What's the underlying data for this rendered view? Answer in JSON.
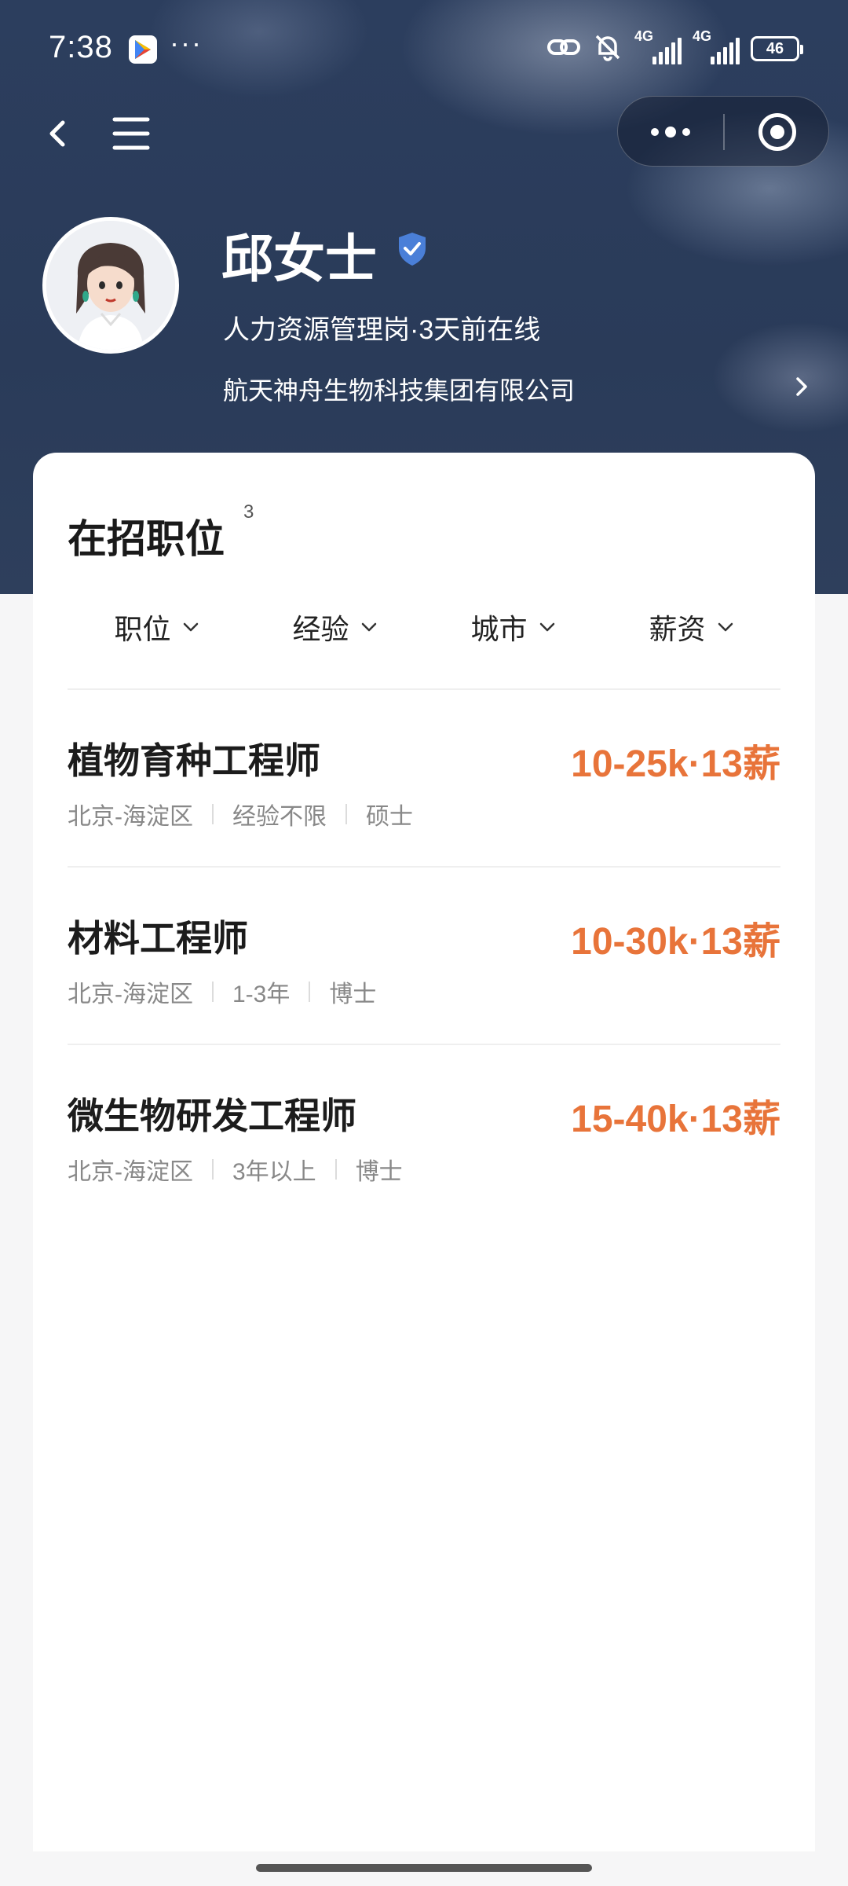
{
  "status_bar": {
    "time": "7:38",
    "more": "···",
    "network_label": "4G",
    "battery": "46",
    "icons": [
      "play-store-icon",
      "link-icon",
      "bell-muted-icon",
      "signal-icon",
      "battery-icon"
    ]
  },
  "nav": {
    "icons": [
      "back-arrow-icon",
      "menu-icon",
      "more-icon",
      "close-circle-icon"
    ]
  },
  "profile": {
    "name": "邱女士",
    "title_line": "人力资源管理岗·3天前在线",
    "company": "航天神舟生物科技集团有限公司",
    "verified_icon": "verified-shield-icon"
  },
  "jobs_section": {
    "title": "在招职位",
    "count": "3",
    "filters": [
      {
        "label": "职位"
      },
      {
        "label": "经验"
      },
      {
        "label": "城市"
      },
      {
        "label": "薪资"
      }
    ],
    "items": [
      {
        "title": "植物育种工程师",
        "salary": "10-25k·13薪",
        "location": "北京-海淀区",
        "experience": "经验不限",
        "education": "硕士"
      },
      {
        "title": "材料工程师",
        "salary": "10-30k·13薪",
        "location": "北京-海淀区",
        "experience": "1-3年",
        "education": "博士"
      },
      {
        "title": "微生物研发工程师",
        "salary": "15-40k·13薪",
        "location": "北京-海淀区",
        "experience": "3年以上",
        "education": "博士"
      }
    ]
  },
  "colors": {
    "header_bg": "#2a3b59",
    "salary": "#e8743a",
    "verified": "#4a7fd8"
  }
}
